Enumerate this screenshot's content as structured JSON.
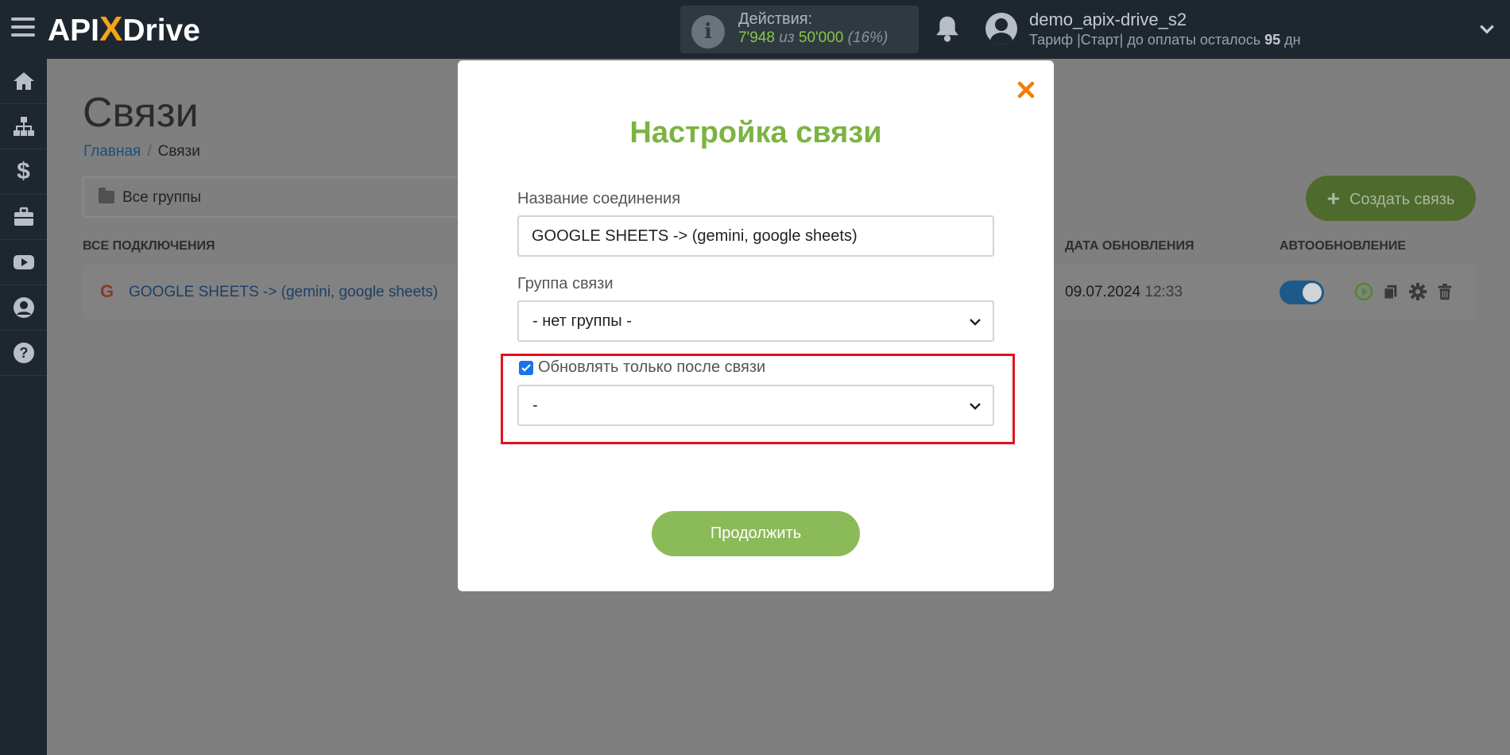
{
  "app": {
    "logo_part1": "API",
    "logo_x": "X",
    "logo_part2": "Drive"
  },
  "header": {
    "actions_label": "Действия:",
    "actions_used": "7'948",
    "actions_of": "из",
    "actions_total": "50'000",
    "actions_percent": "(16%)",
    "user_name": "demo_apix-drive_s2",
    "tariff_text": "Тариф |Старт| до оплаты осталось",
    "tariff_days": "95",
    "tariff_days_unit": "дн"
  },
  "sidebar": {
    "items": [
      {
        "icon": "home-icon"
      },
      {
        "icon": "sitemap-icon"
      },
      {
        "icon": "dollar-icon",
        "glyph": "$"
      },
      {
        "icon": "briefcase-icon"
      },
      {
        "icon": "youtube-icon"
      },
      {
        "icon": "user-icon"
      },
      {
        "icon": "help-icon"
      }
    ]
  },
  "page": {
    "title": "Связи",
    "breadcrumb_home": "Главная",
    "breadcrumb_sep": "/",
    "breadcrumb_current": "Связи",
    "group_filter": "Все группы",
    "create_button": "Создать связь",
    "create_plus": "+",
    "columns": {
      "all_connections": "ВСЕ ПОДКЛЮЧЕНИЯ",
      "update_date": "ДАТА ОБНОВЛЕНИЯ",
      "auto_update": "АВТООБНОВЛЕНИЕ"
    },
    "rows": [
      {
        "icon_letter": "G",
        "name": "GOOGLE SHEETS -> (gemini, google sheets)",
        "date": "09.07.2024",
        "time": "12:33",
        "auto_update": true
      }
    ]
  },
  "modal": {
    "title": "Настройка связи",
    "name_label": "Название соединения",
    "name_value": "GOOGLE SHEETS -> (gemini, google sheets)",
    "group_label": "Группа связи",
    "group_value": "- нет группы -",
    "update_after_label": "Обновлять только после связи",
    "update_after_checked": true,
    "update_after_value": "-",
    "continue_button": "Продолжить"
  },
  "colors": {
    "accent_green": "#8bba59",
    "title_green": "#7cb342",
    "highlight_red": "#e0121f",
    "close_orange": "#f57c00"
  }
}
